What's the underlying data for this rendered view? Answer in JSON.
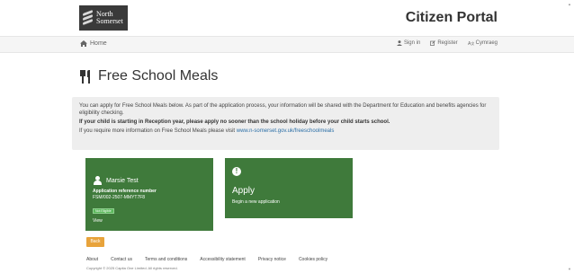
{
  "header": {
    "logo_line1": "North",
    "logo_line2": "Somerset",
    "title": "Citizen Portal"
  },
  "nav": {
    "home": "Home",
    "sign_in": "Sign in",
    "register": "Register",
    "cymraeg": "Cymraeg"
  },
  "page": {
    "title": "Free School Meals"
  },
  "info": {
    "line1": "You can apply for Free School Meals below. As part of the application process, your information will be shared with the Department for Education and benefits agencies for eligibility checking.",
    "line2": "If your child is starting in Reception year, please apply no sooner than the school holiday before your child starts school.",
    "line3_prefix": "If you require more information on Free School Meals please visit ",
    "line3_link": "www.n-somerset.gov.uk/freeschoolmeals"
  },
  "cards": {
    "user": {
      "name": "Marsie Test",
      "ref_label": "Application reference number",
      "ref_value": "FSM/002-2507-MMYT7F8",
      "badge": "Not Eligible",
      "view": "View"
    },
    "apply": {
      "title": "Apply",
      "subtitle": "Begin a new application"
    }
  },
  "back": "Back",
  "footer": {
    "links": [
      "About",
      "Contact us",
      "Terms and conditions",
      "Accessibility statement",
      "Privacy notice",
      "Cookies policy"
    ],
    "copyright": "Copyright © 2025 Capita One Limited. All rights reserved."
  },
  "colors": {
    "card_green": "#3f7a3b",
    "back_orange": "#e8a33b",
    "link_blue": "#2a6ea6"
  }
}
